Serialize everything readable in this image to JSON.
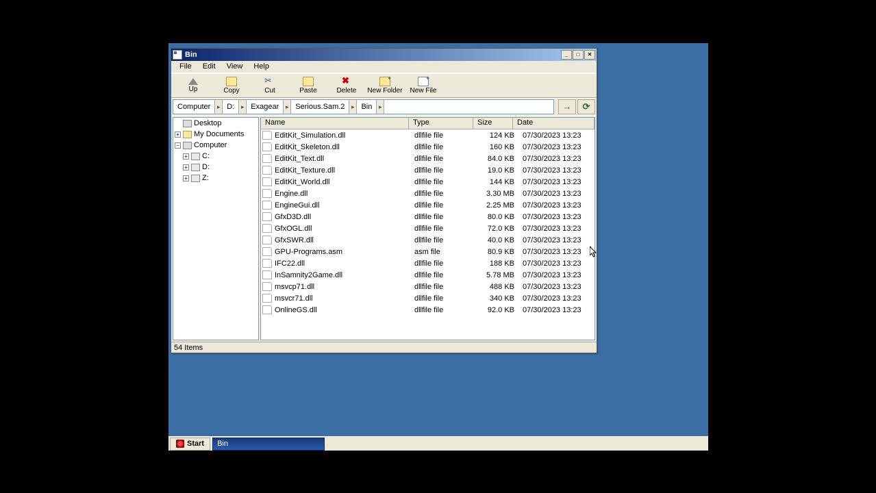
{
  "window": {
    "title": "Bin",
    "min_label": "_",
    "max_label": "□",
    "close_label": "✕"
  },
  "menu": {
    "file": "File",
    "edit": "Edit",
    "view": "View",
    "help": "Help"
  },
  "toolbar": {
    "up": "Up",
    "copy": "Copy",
    "cut": "Cut",
    "paste": "Paste",
    "delete": "Delete",
    "new_folder": "New Folder",
    "new_file": "New File"
  },
  "path": {
    "segments": [
      "Computer",
      "D:",
      "Exagear",
      "Serious.Sam.2",
      "Bin"
    ],
    "go_label": "→",
    "refresh_label": "⟳"
  },
  "tree": {
    "desktop": "Desktop",
    "my_documents": "My Documents",
    "computer": "Computer",
    "c_drive": "C:",
    "d_drive": "D:",
    "z_drive": "Z:"
  },
  "columns": {
    "name": "Name",
    "type": "Type",
    "size": "Size",
    "date": "Date"
  },
  "files": [
    {
      "name": "EditKit_Simulation.dll",
      "type": "dllfile file",
      "size": "124 KB",
      "date": "07/30/2023 13:23"
    },
    {
      "name": "EditKit_Skeleton.dll",
      "type": "dllfile file",
      "size": "160 KB",
      "date": "07/30/2023 13:23"
    },
    {
      "name": "EditKit_Text.dll",
      "type": "dllfile file",
      "size": "84.0 KB",
      "date": "07/30/2023 13:23"
    },
    {
      "name": "EditKit_Texture.dll",
      "type": "dllfile file",
      "size": "19.0 KB",
      "date": "07/30/2023 13:23"
    },
    {
      "name": "EditKit_World.dll",
      "type": "dllfile file",
      "size": "144 KB",
      "date": "07/30/2023 13:23"
    },
    {
      "name": "Engine.dll",
      "type": "dllfile file",
      "size": "3.30 MB",
      "date": "07/30/2023 13:23"
    },
    {
      "name": "EngineGui.dll",
      "type": "dllfile file",
      "size": "2.25 MB",
      "date": "07/30/2023 13:23"
    },
    {
      "name": "GfxD3D.dll",
      "type": "dllfile file",
      "size": "80.0 KB",
      "date": "07/30/2023 13:23"
    },
    {
      "name": "GfxOGL.dll",
      "type": "dllfile file",
      "size": "72.0 KB",
      "date": "07/30/2023 13:23"
    },
    {
      "name": "GfxSWR.dll",
      "type": "dllfile file",
      "size": "40.0 KB",
      "date": "07/30/2023 13:23"
    },
    {
      "name": "GPU-Programs.asm",
      "type": "asm file",
      "size": "80.9 KB",
      "date": "07/30/2023 13:23"
    },
    {
      "name": "IFC22.dll",
      "type": "dllfile file",
      "size": "188 KB",
      "date": "07/30/2023 13:23"
    },
    {
      "name": "InSamnity2Game.dll",
      "type": "dllfile file",
      "size": "5.78 MB",
      "date": "07/30/2023 13:23"
    },
    {
      "name": "msvcp71.dll",
      "type": "dllfile file",
      "size": "488 KB",
      "date": "07/30/2023 13:23"
    },
    {
      "name": "msvcr71.dll",
      "type": "dllfile file",
      "size": "340 KB",
      "date": "07/30/2023 13:23"
    },
    {
      "name": "OnlineGS.dll",
      "type": "dllfile file",
      "size": "92.0 KB",
      "date": "07/30/2023 13:23"
    }
  ],
  "status": {
    "text": "54 Items"
  },
  "taskbar": {
    "start": "Start",
    "task": "Bin"
  }
}
